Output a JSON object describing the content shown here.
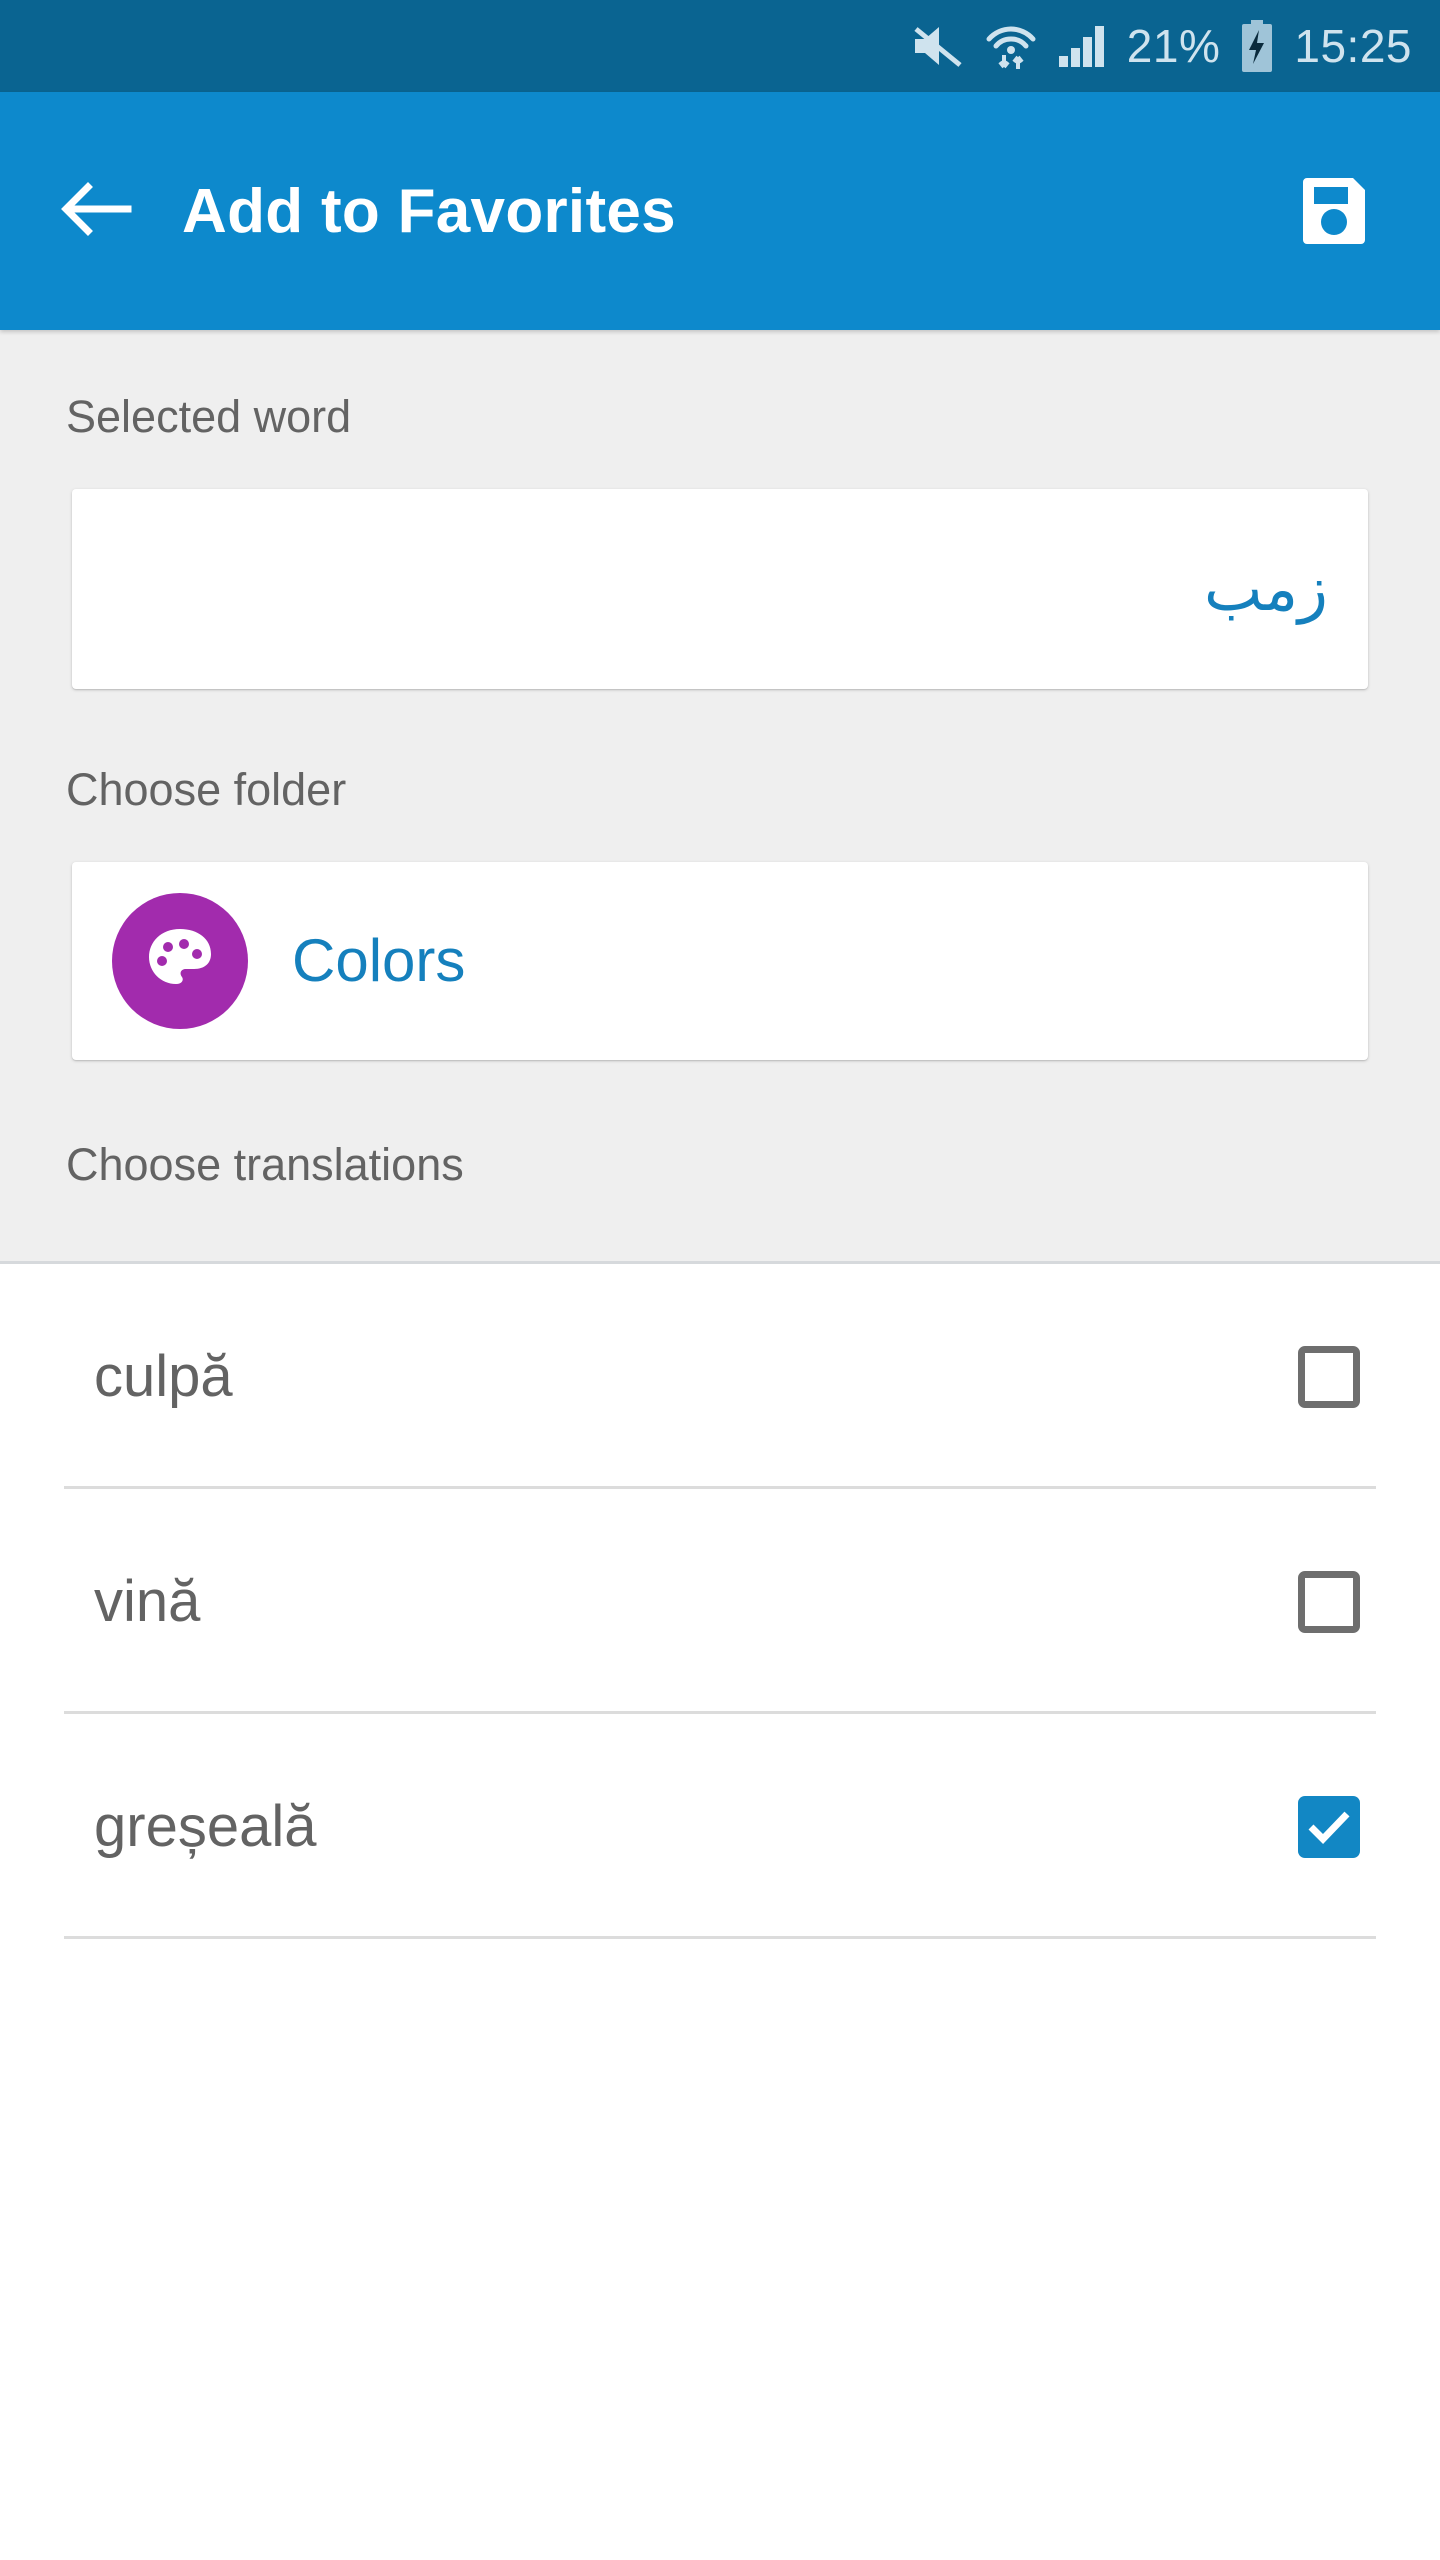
{
  "status_bar": {
    "battery_percent": "21%",
    "time": "15:25",
    "icons": [
      "volume-mute-icon",
      "wifi-icon",
      "cellular-signal-icon",
      "battery-charging-icon"
    ],
    "background_color": "#0a6491",
    "text_color": "#cfe3ee"
  },
  "app_bar": {
    "title": "Add to Favorites",
    "back_icon": "arrow-left-icon",
    "save_icon": "floppy-save-icon",
    "background_color": "#0d89cc",
    "title_color": "#ffffff"
  },
  "form": {
    "selected_word_label": "Selected word",
    "selected_word_value": "زمب",
    "selected_word_color": "#1580bd",
    "choose_folder_label": "Choose folder",
    "folder_name": "Colors",
    "folder_name_color": "#1580bd",
    "folder_icon": "palette-icon",
    "folder_avatar_color": "#a22bad",
    "choose_translations_label": "Choose translations",
    "section_background": "#efefef"
  },
  "translations": [
    {
      "label": "culpă",
      "checked": false
    },
    {
      "label": "vină",
      "checked": false
    },
    {
      "label": "greșeală",
      "checked": true
    }
  ],
  "theme": {
    "accent": "#1287c4",
    "checkbox_off": "#6e6e6e",
    "divider": "#dcdcdc",
    "body_text": "#636363"
  }
}
